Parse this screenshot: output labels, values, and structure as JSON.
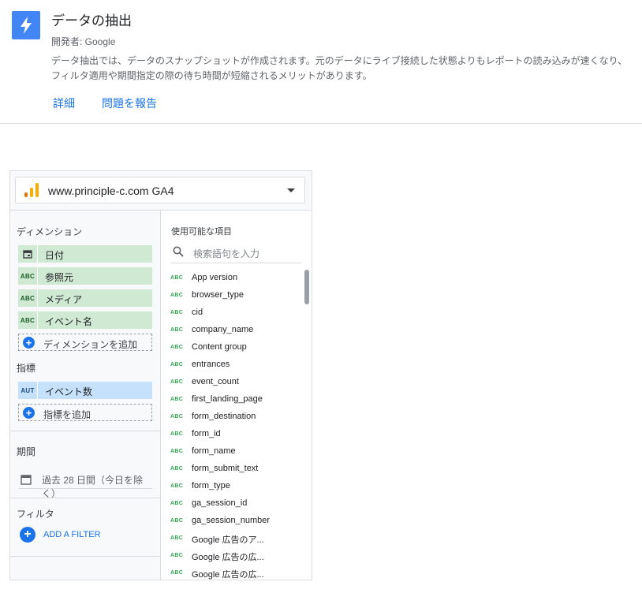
{
  "connector": {
    "title": "データの抽出",
    "developer": "開発者: Google",
    "description": "データ抽出では、データのスナップショットが作成されます。元のデータにライブ接続した状態よりもレポートの読み込みが速くなり、フィルタ適用や期間指定の際の待ち時間が短縮されるメリットがあります。",
    "links": {
      "details": "詳細",
      "report": "問題を報告"
    },
    "logo_icon": "lightning-bolt-icon"
  },
  "data_source": {
    "name": "www.principle-c.com GA4",
    "icon": "analytics-bars-icon"
  },
  "dimensions": {
    "header": "ディメンション",
    "items": [
      {
        "icon": "calendar-icon",
        "label": "日付"
      },
      {
        "icon": "ABC",
        "label": "参照元"
      },
      {
        "icon": "ABC",
        "label": "メディア"
      },
      {
        "icon": "ABC",
        "label": "イベント名"
      }
    ],
    "add_label": "ディメンションを追加"
  },
  "metrics": {
    "header": "指標",
    "items": [
      {
        "icon": "AUT",
        "label": "イベント数"
      }
    ],
    "add_label": "指標を追加"
  },
  "period": {
    "header": "期間",
    "value": "過去 28 日間（今日を除く）"
  },
  "filter": {
    "header": "フィルタ",
    "add_label": "ADD A FILTER"
  },
  "available": {
    "header": "使用可能な項目",
    "search_placeholder": "検索語句を入力",
    "type_badge": "ABC",
    "fields": [
      "App version",
      "browser_type",
      "cid",
      "company_name",
      "Content group",
      "entrances",
      "event_count",
      "first_landing_page",
      "form_destination",
      "form_id",
      "form_name",
      "form_submit_text",
      "form_type",
      "ga_session_id",
      "ga_session_number",
      "Google 広告のア...",
      "Google 広告の広...",
      "Google 広告の広..."
    ]
  },
  "colors": {
    "accent": "#1a73e8",
    "dimension_chip": "#cfe9d3",
    "metric_chip": "#c5e1fb",
    "logo_bg": "#4285f4"
  }
}
